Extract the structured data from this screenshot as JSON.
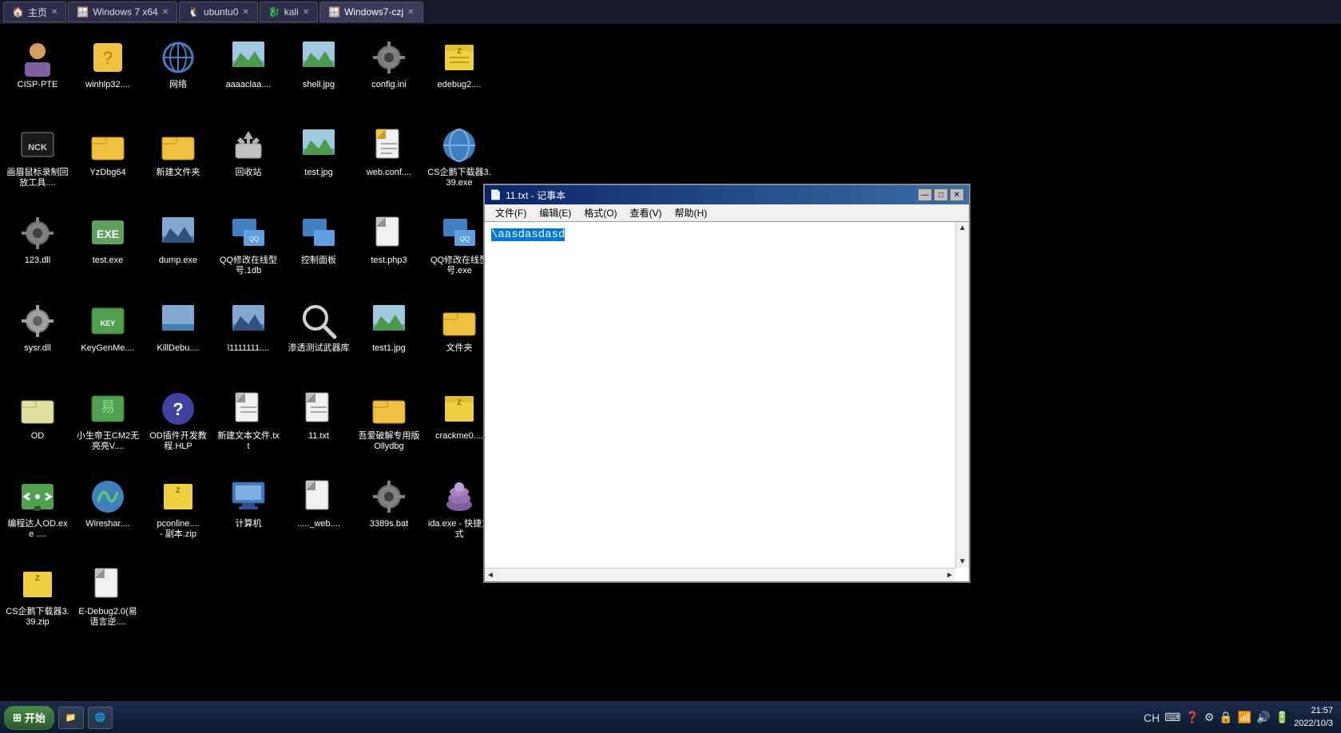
{
  "taskbar_top": {
    "tabs": [
      {
        "id": "tab-home",
        "label": "主页",
        "icon": "🏠",
        "active": false
      },
      {
        "id": "tab-win7",
        "label": "Windows 7 x64",
        "icon": "🪟",
        "active": false
      },
      {
        "id": "tab-ubuntu",
        "label": "ubuntu0",
        "icon": "🐧",
        "active": false
      },
      {
        "id": "tab-kali",
        "label": "kali",
        "icon": "🐉",
        "active": false
      },
      {
        "id": "tab-win7czj",
        "label": "Windows7-czj",
        "icon": "🪟",
        "active": true
      }
    ]
  },
  "desktop_icons": [
    {
      "id": "icon-cisp",
      "label": "CISP-PTE",
      "type": "person",
      "row": 0,
      "col": 0
    },
    {
      "id": "icon-winhlp",
      "label": "winhlp32....",
      "type": "question",
      "row": 0,
      "col": 1
    },
    {
      "id": "icon-network",
      "label": "网络",
      "type": "network",
      "row": 0,
      "col": 2
    },
    {
      "id": "icon-aaaaclaa",
      "label": "aaaaclaa....",
      "type": "landscape",
      "row": 0,
      "col": 3
    },
    {
      "id": "icon-shelljpg",
      "label": "shell.jpg",
      "type": "landscape",
      "row": 0,
      "col": 4
    },
    {
      "id": "icon-configini",
      "label": "config.ini",
      "type": "gear",
      "row": 0,
      "col": 5
    },
    {
      "id": "icon-edebug",
      "label": "edebug2....",
      "type": "zip",
      "row": 0,
      "col": 6
    },
    {
      "id": "icon-nck",
      "label": "画眉鼠标录制回放工具....",
      "type": "nck",
      "row": 0,
      "col": 7
    },
    {
      "id": "icon-yzdbg",
      "label": "YzDbg64",
      "type": "folder-yellow",
      "row": 1,
      "col": 0
    },
    {
      "id": "icon-newfolder",
      "label": "新建文件夹",
      "type": "folder-yellow",
      "row": 1,
      "col": 1
    },
    {
      "id": "icon-recycle",
      "label": "回收站",
      "type": "recycle",
      "row": 1,
      "col": 2
    },
    {
      "id": "icon-testjpg",
      "label": "test.jpg",
      "type": "landscape",
      "row": 1,
      "col": 3
    },
    {
      "id": "icon-webconf",
      "label": "web.conf....",
      "type": "file",
      "row": 1,
      "col": 4
    },
    {
      "id": "icon-cs",
      "label": "CS企鹅下载器3.39.exe",
      "type": "globe",
      "row": 1,
      "col": 5
    },
    {
      "id": "icon-123dll",
      "label": "123.dll",
      "type": "gear",
      "row": 1,
      "col": 6
    },
    {
      "id": "icon-testexe",
      "label": "test.exe",
      "type": "testexe",
      "row": 1,
      "col": 7
    },
    {
      "id": "icon-dump",
      "label": "dump.exe",
      "type": "landscape-blue",
      "row": 2,
      "col": 0
    },
    {
      "id": "icon-qqmod1",
      "label": "QQ修改在线型号.1db",
      "type": "monitor",
      "row": 2,
      "col": 1
    },
    {
      "id": "icon-control",
      "label": "控制面板",
      "type": "monitor",
      "row": 2,
      "col": 2
    },
    {
      "id": "icon-testphp",
      "label": "test.php3",
      "type": "file",
      "row": 2,
      "col": 3
    },
    {
      "id": "icon-qqmod2",
      "label": "QQ修改在线型号.exe",
      "type": "monitor",
      "row": 2,
      "col": 4
    },
    {
      "id": "icon-sysrdll",
      "label": "sysr.dll",
      "type": "gear-gray",
      "row": 2,
      "col": 5
    },
    {
      "id": "icon-keygen",
      "label": "KeyGenMe....",
      "type": "keygen",
      "row": 2,
      "col": 6
    },
    {
      "id": "icon-killdebug",
      "label": "KillDebu....",
      "type": "landscape-blue",
      "row": 3,
      "col": 0
    },
    {
      "id": "icon-l1111",
      "label": "l1111111....",
      "type": "landscape-blue",
      "row": 3,
      "col": 1
    },
    {
      "id": "icon-pentest",
      "label": "渗透测试武器库",
      "type": "search",
      "row": 3,
      "col": 2
    },
    {
      "id": "icon-test1jpg",
      "label": "test1.jpg",
      "type": "landscape",
      "row": 3,
      "col": 3
    },
    {
      "id": "icon-folder2",
      "label": "文件夹",
      "type": "folder-yellow",
      "row": 3,
      "col": 4
    },
    {
      "id": "icon-od",
      "label": "OD",
      "type": "folder-empty",
      "row": 3,
      "col": 5
    },
    {
      "id": "icon-xiaosheng",
      "label": "小生帝王CM2无亮亮V....",
      "type": "keygen2",
      "row": 3,
      "col": 6
    },
    {
      "id": "icon-od-plugin",
      "label": "OD插件开发教程.HLP",
      "type": "help-blue",
      "row": 4,
      "col": 0
    },
    {
      "id": "icon-newtxt",
      "label": "新建文本文件.txt",
      "type": "file",
      "row": 4,
      "col": 1
    },
    {
      "id": "icon-11txt",
      "label": "11.txt",
      "type": "file",
      "row": 4,
      "col": 2
    },
    {
      "id": "icon-xingaipo",
      "label": "吾爱破解专用版Ollydbg",
      "type": "folder-yellow",
      "row": 4,
      "col": 3
    },
    {
      "id": "icon-crackme",
      "label": "crackme0....",
      "type": "zip2",
      "row": 4,
      "col": 4
    },
    {
      "id": "icon-biancheng",
      "label": "编程达人OD.exe ....",
      "type": "biancheng",
      "row": 4,
      "col": 5
    },
    {
      "id": "icon-wireshark",
      "label": "Wireshar....",
      "type": "wireshark",
      "row": 4,
      "col": 6
    },
    {
      "id": "icon-pconline",
      "label": "pconline....\n- 副本.zip",
      "type": "zip3",
      "row": 5,
      "col": 0
    },
    {
      "id": "icon-computer",
      "label": "计算机",
      "type": "computer",
      "row": 5,
      "col": 1
    },
    {
      "id": "icon-web2",
      "label": "....._web....",
      "type": "file",
      "row": 5,
      "col": 2
    },
    {
      "id": "icon-3389bat",
      "label": "3389s.bat",
      "type": "gear",
      "row": 5,
      "col": 3
    },
    {
      "id": "icon-idaexe",
      "label": "ida.exe - 快捷方式",
      "type": "idaexe",
      "row": 5,
      "col": 4
    },
    {
      "id": "icon-cs2",
      "label": "CS企鹅下载器3.39.zip",
      "type": "zip3",
      "row": 5,
      "col": 5
    },
    {
      "id": "icon-edebug2",
      "label": "E-Debug2.0(易语言逆....",
      "type": "file",
      "row": 5,
      "col": 6
    }
  ],
  "notepad": {
    "title": "11.txt - 记事本",
    "title_icon": "📄",
    "content": "\\aasdasdasd",
    "menu": {
      "file": "文件(F)",
      "edit": "编辑(E)",
      "format": "格式(O)",
      "view": "查看(V)",
      "help": "帮助(H)"
    },
    "controls": {
      "minimize": "—",
      "maximize": "□",
      "close": "✕"
    }
  },
  "taskbar_bottom": {
    "start_label": "开始",
    "items": [
      {
        "label": "📁",
        "active": false
      },
      {
        "label": "🌐",
        "active": false
      }
    ],
    "systray": {
      "lang": "CH",
      "clock_time": "21:57",
      "clock_date": "2022/10/3"
    }
  }
}
